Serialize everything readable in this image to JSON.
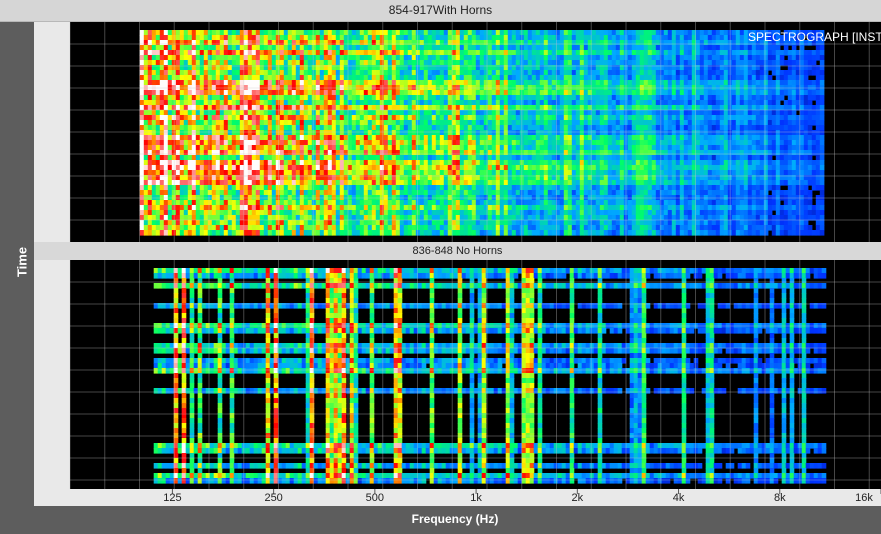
{
  "window": {
    "title": "854-917With Horns"
  },
  "chart_data": {
    "type": "heatmap",
    "xlabel": "Frequency (Hz)",
    "ylabel": "Time",
    "x_scale": "log",
    "xlim": [
      62,
      16000
    ],
    "ticks": [
      {
        "value": 125,
        "label": "125"
      },
      {
        "value": 250,
        "label": "250"
      },
      {
        "value": 500,
        "label": "500"
      },
      {
        "value": 1000,
        "label": "1k"
      },
      {
        "value": 2000,
        "label": "2k"
      },
      {
        "value": 4000,
        "label": "4k"
      },
      {
        "value": 8000,
        "label": "8k"
      },
      {
        "value": 16000,
        "label": "16k"
      }
    ],
    "grid": true,
    "colorscale": [
      "#000000",
      "#0033ff",
      "#00aaff",
      "#00ff66",
      "#ffff00",
      "#ff0000",
      "#ffffff"
    ],
    "panels": [
      {
        "title": "854-917With Horns",
        "overlay": "SPECTROGRAPH [INST",
        "profile": "dense",
        "freq_extent": [
          100,
          11000
        ]
      },
      {
        "title": "836-848 No Horns",
        "profile": "sparse",
        "freq_extent": [
          110,
          11000
        ]
      }
    ]
  }
}
